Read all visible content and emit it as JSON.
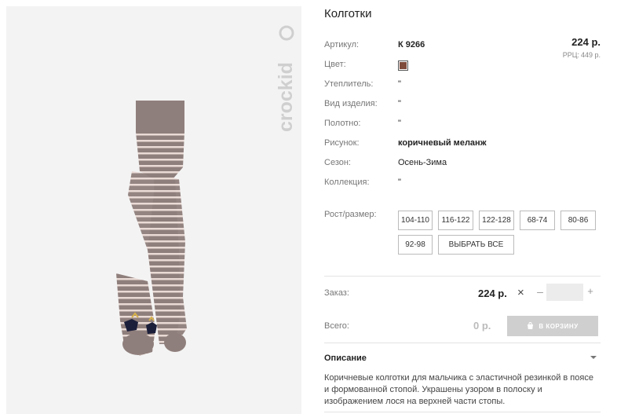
{
  "product": {
    "title": "Колготки",
    "price": "224 р.",
    "rrp_label": "РРЦ:",
    "rrp_value": "449 р.",
    "color_hex": "#7e4a3a",
    "image_desc_icon": "striped-tights-image",
    "brand_logo": "crockid"
  },
  "specs": [
    {
      "label": "Артикул:",
      "value": "К 9266"
    },
    {
      "label": "Цвет:",
      "value": ""
    },
    {
      "label": "Утеплитель:",
      "value": "\""
    },
    {
      "label": "Вид изделия:",
      "value": "\""
    },
    {
      "label": "Полотно:",
      "value": "\""
    },
    {
      "label": "Рисунок:",
      "value": "коричневый меланж"
    },
    {
      "label": "Сезон:",
      "value": "Осень-Зима"
    },
    {
      "label": "Коллекция:",
      "value": "\""
    }
  ],
  "sizes": {
    "label": "Рост/размер:",
    "options": [
      "104-110",
      "116-122",
      "122-128",
      "68-74",
      "80-86",
      "92-98"
    ],
    "select_all": "ВЫБРАТЬ ВСЕ"
  },
  "order": {
    "label": "Заказ:",
    "price": "224 р.",
    "times": "×",
    "minus": "–",
    "plus": "+",
    "quantity": ""
  },
  "total": {
    "label": "Всего:",
    "value": "0 р.",
    "cart_button": "В КОРЗИНУ"
  },
  "description": {
    "heading": "Описание",
    "text": "Коричневые колготки для мальчика с эластичной резинкой в поясе и формованной стопой. Украшены узором в полоску и изображением лося на верхней части стопы."
  }
}
